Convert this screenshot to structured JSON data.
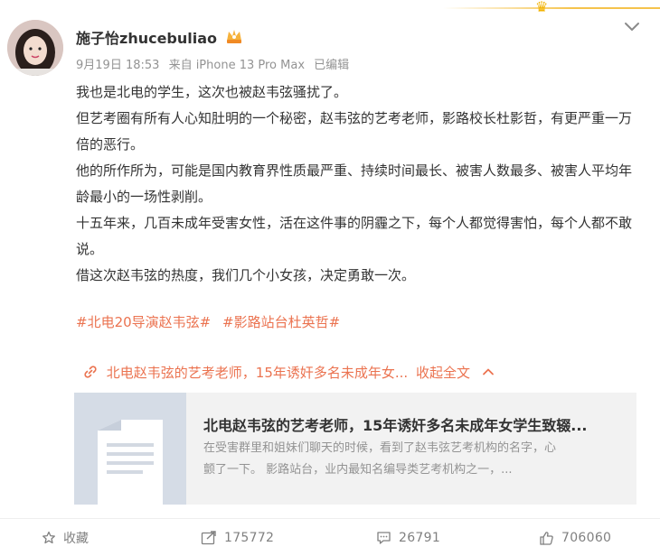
{
  "post": {
    "username": "施子怡zhucebuliao",
    "date": "9月19日 18:53",
    "source": "来自 iPhone 13 Pro Max",
    "edited": "已编辑",
    "paragraphs": [
      "我也是北电的学生，这次也被赵韦弦骚扰了。",
      "但艺考圈有所有人心知肚明的一个秘密，赵韦弦的艺考老师，影路校长杜影哲，有更严重一万倍的恶行。",
      "他的所作所为，可能是国内教育界性质最严重、持续时间最长、被害人数最多、被害人平均年龄最小的一场性剥削。",
      "十五年来，几百未成年受害女性，活在这件事的阴霾之下，每个人都觉得害怕，每个人都不敢说。",
      "借这次赵韦弦的热度，我们几个小女孩，决定勇敢一次。"
    ],
    "hashtags": [
      "#北电20导演赵韦弦#",
      "#影路站台杜英哲#"
    ],
    "link_text": "北电赵韦弦的艺考老师，15年诱奸多名未成年女...",
    "collapse_label": "收起全文",
    "card": {
      "title": "北电赵韦弦的艺考老师，15年诱奸多名未成年女学生致辍...",
      "desc_line1": "在受害群里和姐妹们聊天的时候，看到了赵韦弦艺考机构的名字，心",
      "desc_line2": "颤了一下。 影路站台，业内最知名编导类艺考机构之一，..."
    }
  },
  "actions": {
    "favorite_label": "收藏",
    "repost_count": "175772",
    "comment_count": "26791",
    "like_count": "706060"
  },
  "colors": {
    "accent": "#eb7350",
    "text": "#333333",
    "muted": "#939393"
  },
  "icons": [
    "vip-crown-icon",
    "chevron-down-icon",
    "link-icon",
    "chevron-up-icon",
    "star-icon",
    "repost-icon",
    "comment-icon",
    "like-icon",
    "crown-icon"
  ]
}
